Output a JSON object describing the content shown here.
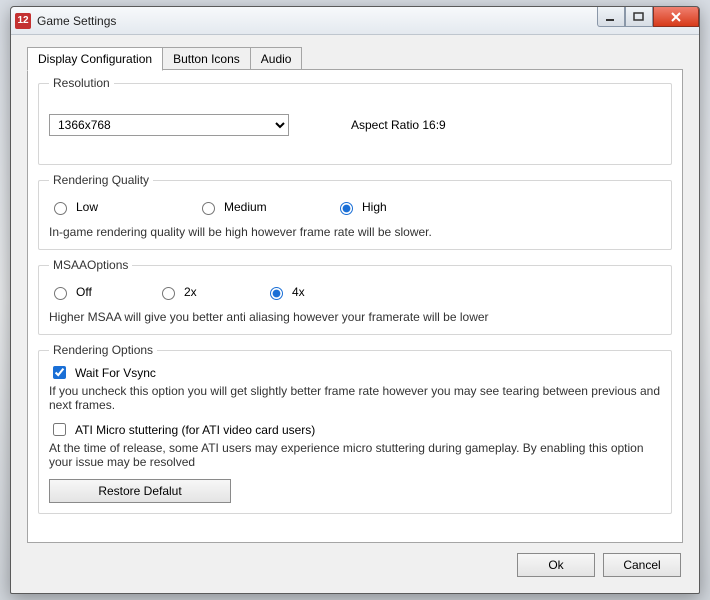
{
  "window": {
    "icon_text": "12",
    "title": "Game Settings"
  },
  "tabs": [
    {
      "label": "Display Configuration",
      "active": true
    },
    {
      "label": "Button Icons",
      "active": false
    },
    {
      "label": "Audio",
      "active": false
    }
  ],
  "resolution": {
    "legend": "Resolution",
    "value": "1366x768",
    "aspect_label": "Aspect Ratio 16:9"
  },
  "rendering_quality": {
    "legend": "Rendering Quality",
    "options": {
      "low": "Low",
      "medium": "Medium",
      "high": "High"
    },
    "selected": "high",
    "hint": "In-game rendering quality will be high however frame rate will be slower."
  },
  "msaa": {
    "legend": "MSAAOptions",
    "options": {
      "off": "Off",
      "x2": "2x",
      "x4": "4x"
    },
    "selected": "x4",
    "hint": "Higher MSAA will give you better anti aliasing however your framerate will be lower"
  },
  "rendering_options": {
    "legend": "Rendering Options",
    "vsync": {
      "label": "Wait For Vsync",
      "checked": true
    },
    "vsync_hint": "If you uncheck this option you will get slightly better frame rate however you may see tearing between previous and next frames.",
    "ati": {
      "label": "ATI Micro stuttering (for ATI video card users)",
      "checked": false
    },
    "ati_hint": "At the time of release, some ATI users may experience micro stuttering during gameplay. By enabling this option your issue may be resolved",
    "restore_label": "Restore Defalut"
  },
  "footer": {
    "ok": "Ok",
    "cancel": "Cancel"
  }
}
